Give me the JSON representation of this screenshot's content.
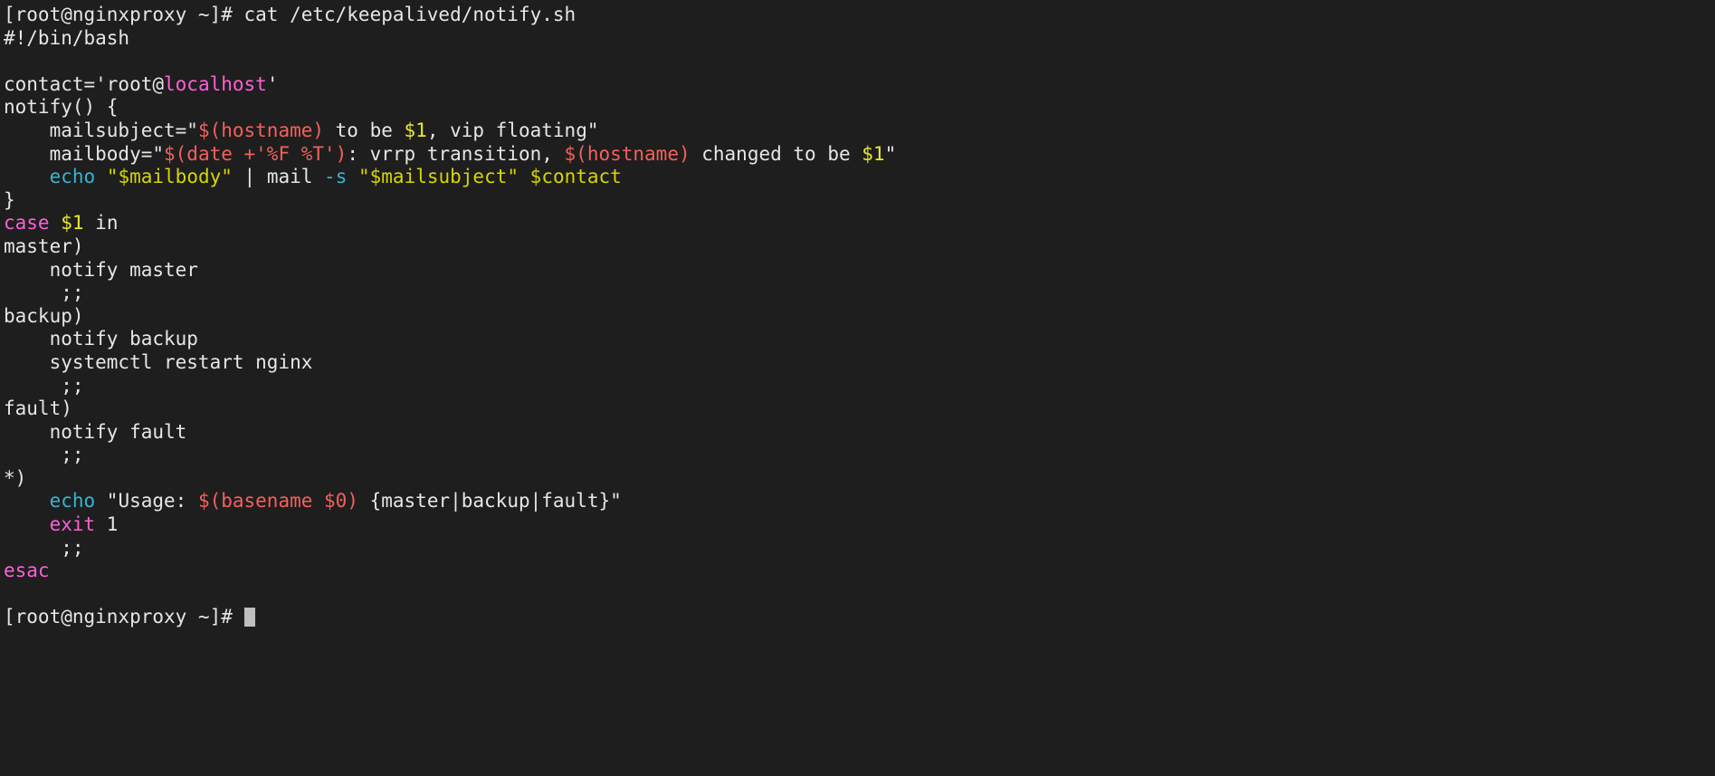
{
  "terminal": {
    "background_color": "#1e1e1e",
    "foreground_color": "#e6e6e6",
    "colors": {
      "magenta": "#ff5fd7",
      "red": "#f4605c",
      "yellow": "#e8e82e",
      "dark_yellow": "#d6d600",
      "cyan": "#34b5d4",
      "cursor": "#bfbfbf"
    },
    "prompt": "[root@nginxproxy ~]#",
    "hostname": "nginxproxy",
    "user": "root",
    "cwd": "~",
    "command": "cat /etc/keepalived/notify.sh",
    "file_path": "/etc/keepalived/notify.sh",
    "lines": [
      {
        "id": "prompt-command",
        "segments": [
          {
            "text": "[root@nginxproxy ~]# cat /etc/keepalived/notify.sh",
            "color": "def"
          }
        ]
      },
      {
        "id": "shebang",
        "segments": [
          {
            "text": "#!/bin/bash",
            "color": "def"
          }
        ]
      },
      {
        "id": "blank-1",
        "segments": [
          {
            "text": " ",
            "color": "def"
          }
        ]
      },
      {
        "id": "contact-assign",
        "segments": [
          {
            "text": "contact='root@",
            "color": "def"
          },
          {
            "text": "localhost",
            "color": "mag"
          },
          {
            "text": "'",
            "color": "def"
          }
        ]
      },
      {
        "id": "notify-func-open",
        "segments": [
          {
            "text": "notify() {",
            "color": "def"
          }
        ]
      },
      {
        "id": "mailsubject-assign",
        "segments": [
          {
            "text": "    mailsubject=\"",
            "color": "def"
          },
          {
            "text": "$(hostname)",
            "color": "red"
          },
          {
            "text": " to be ",
            "color": "def"
          },
          {
            "text": "$1",
            "color": "yel"
          },
          {
            "text": ", vip floating\"",
            "color": "def"
          }
        ]
      },
      {
        "id": "mailbody-assign",
        "segments": [
          {
            "text": "    mailbody=\"",
            "color": "def"
          },
          {
            "text": "$(date +'%F %T')",
            "color": "red"
          },
          {
            "text": ": vrrp transition, ",
            "color": "def"
          },
          {
            "text": "$(hostname)",
            "color": "red"
          },
          {
            "text": " changed to be ",
            "color": "def"
          },
          {
            "text": "$1",
            "color": "yel"
          },
          {
            "text": "\"",
            "color": "def"
          }
        ]
      },
      {
        "id": "echo-mail",
        "segments": [
          {
            "text": "    ",
            "color": "def"
          },
          {
            "text": "echo",
            "color": "cyan"
          },
          {
            "text": " ",
            "color": "def"
          },
          {
            "text": "\"$mailbody\"",
            "color": "yel2"
          },
          {
            "text": " | mail ",
            "color": "def"
          },
          {
            "text": "-s",
            "color": "cyan"
          },
          {
            "text": " ",
            "color": "def"
          },
          {
            "text": "\"$mailsubject\"",
            "color": "yel2"
          },
          {
            "text": " ",
            "color": "def"
          },
          {
            "text": "$contact",
            "color": "yel2"
          }
        ]
      },
      {
        "id": "notify-func-close",
        "segments": [
          {
            "text": "}",
            "color": "def"
          }
        ]
      },
      {
        "id": "case-open",
        "segments": [
          {
            "text": "case",
            "color": "mag"
          },
          {
            "text": " ",
            "color": "def"
          },
          {
            "text": "$1",
            "color": "yel"
          },
          {
            "text": " in",
            "color": "def"
          }
        ]
      },
      {
        "id": "case-master",
        "segments": [
          {
            "text": "master)",
            "color": "def"
          }
        ]
      },
      {
        "id": "master-notify",
        "segments": [
          {
            "text": "    notify master",
            "color": "def"
          }
        ]
      },
      {
        "id": "master-break",
        "segments": [
          {
            "text": "     ;;",
            "color": "def"
          }
        ]
      },
      {
        "id": "case-backup",
        "segments": [
          {
            "text": "backup)",
            "color": "def"
          }
        ]
      },
      {
        "id": "backup-notify",
        "segments": [
          {
            "text": "    notify backup",
            "color": "def"
          }
        ]
      },
      {
        "id": "backup-restart",
        "segments": [
          {
            "text": "    systemctl restart nginx",
            "color": "def"
          }
        ]
      },
      {
        "id": "backup-break",
        "segments": [
          {
            "text": "     ;;",
            "color": "def"
          }
        ]
      },
      {
        "id": "case-fault",
        "segments": [
          {
            "text": "fault)",
            "color": "def"
          }
        ]
      },
      {
        "id": "fault-notify",
        "segments": [
          {
            "text": "    notify fault",
            "color": "def"
          }
        ]
      },
      {
        "id": "fault-break",
        "segments": [
          {
            "text": "     ;;",
            "color": "def"
          }
        ]
      },
      {
        "id": "case-default",
        "segments": [
          {
            "text": "*)",
            "color": "def"
          }
        ]
      },
      {
        "id": "usage-echo",
        "segments": [
          {
            "text": "    ",
            "color": "def"
          },
          {
            "text": "echo",
            "color": "cyan"
          },
          {
            "text": " \"Usage: ",
            "color": "def"
          },
          {
            "text": "$(basename $0)",
            "color": "red"
          },
          {
            "text": " {master|backup|fault}\"",
            "color": "def"
          }
        ]
      },
      {
        "id": "exit-1",
        "segments": [
          {
            "text": "    ",
            "color": "def"
          },
          {
            "text": "exit",
            "color": "mag"
          },
          {
            "text": " 1",
            "color": "def"
          }
        ]
      },
      {
        "id": "default-break",
        "segments": [
          {
            "text": "     ;;",
            "color": "def"
          }
        ]
      },
      {
        "id": "esac-close",
        "segments": [
          {
            "text": "esac",
            "color": "mag"
          }
        ]
      },
      {
        "id": "blank-2",
        "segments": [
          {
            "text": " ",
            "color": "def"
          }
        ]
      },
      {
        "id": "final-prompt",
        "segments": [
          {
            "text": "[root@nginxproxy ~]# ",
            "color": "def"
          }
        ],
        "cursor": true
      }
    ]
  }
}
